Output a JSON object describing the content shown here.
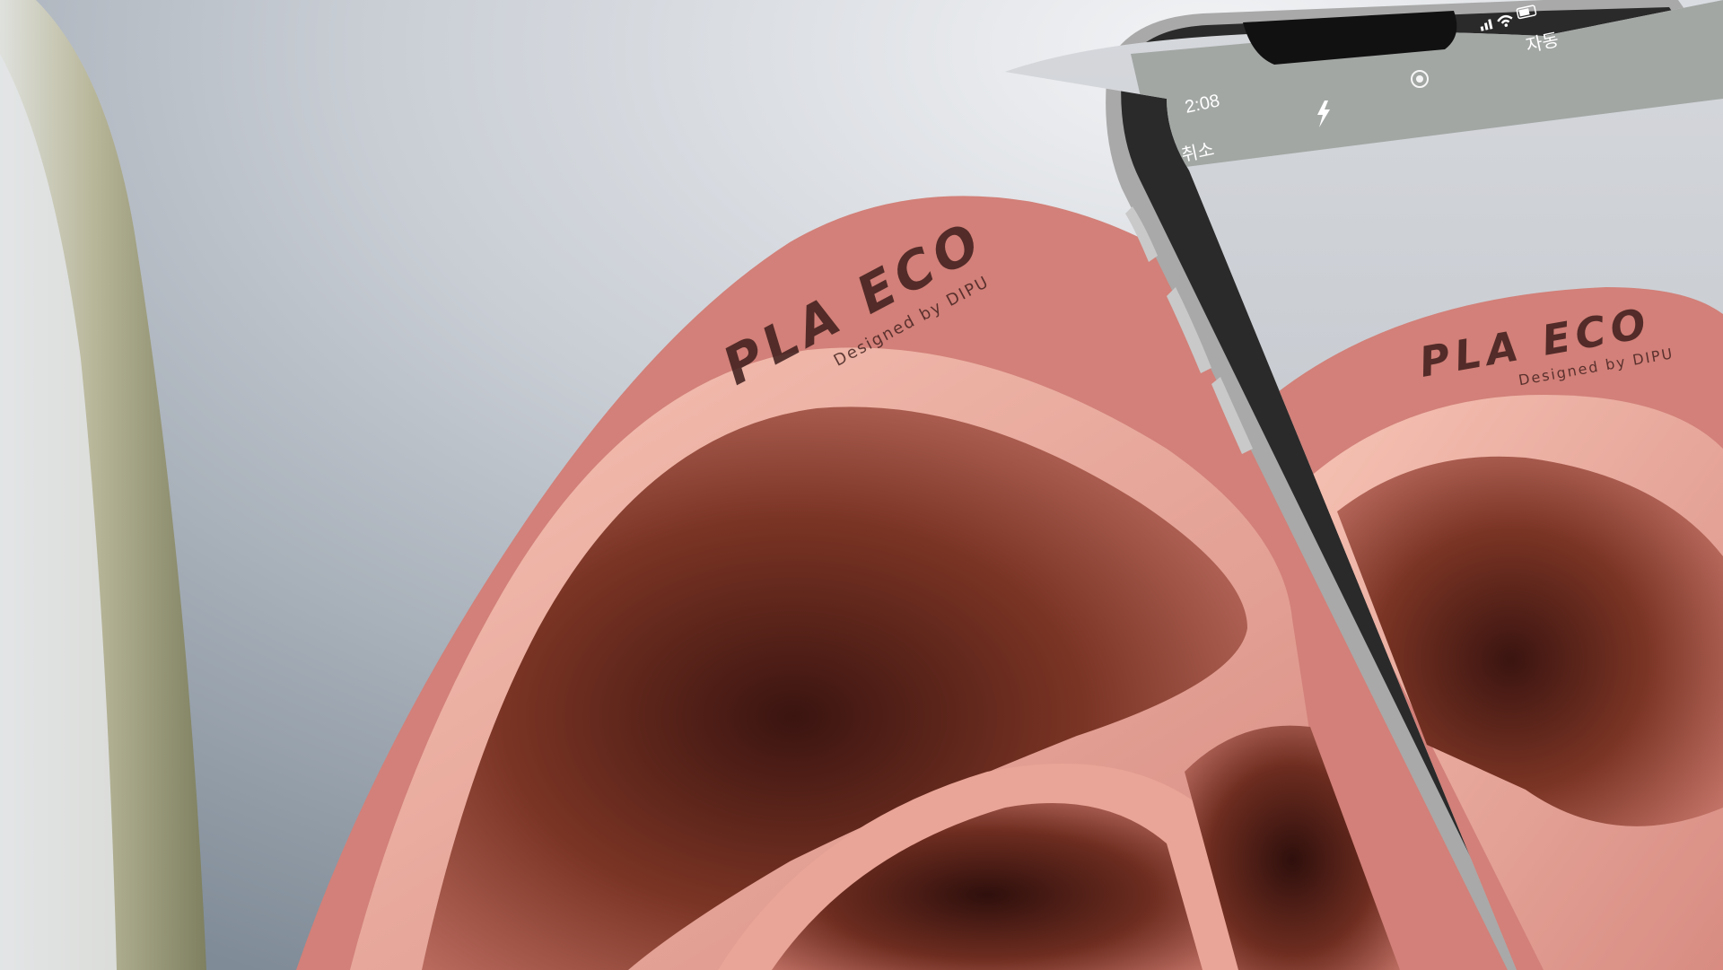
{
  "brand": {
    "logo": "PLA ECO",
    "tagline": "Designed by DIPU"
  },
  "phone": {
    "status_time": "2:08",
    "cancel_label": "취소",
    "auto_label": "자동"
  },
  "colors": {
    "plate": "#d5847f",
    "plate_rim": "#f2b3a4",
    "plate_well": "#6b2a24",
    "background": "#c9ced6",
    "phone_frame": "#b8b8b8",
    "screen_bar": "#f2f2f2"
  },
  "icons": {
    "flash": "flash-icon",
    "live_photo": "live-photo-icon",
    "signal": "signal-icon",
    "wifi": "wifi-icon",
    "battery": "battery-icon"
  }
}
